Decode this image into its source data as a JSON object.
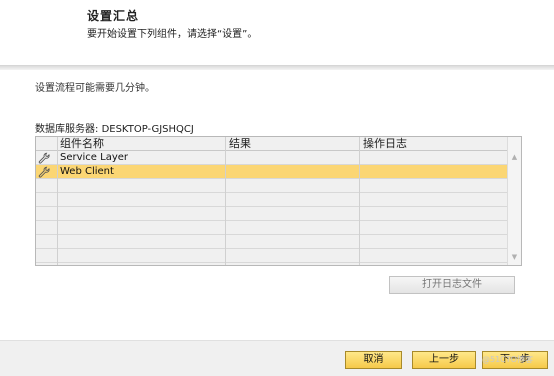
{
  "header": {
    "title": "设置汇总",
    "subtitle": "要开始设置下列组件，请选择“设置”。"
  },
  "info": "设置流程可能需要几分钟。",
  "server": {
    "label": "数据库服务器:",
    "value": "DESKTOP-GJSHQCJ"
  },
  "grid": {
    "columns": [
      "组件名称",
      "结果",
      "操作日志"
    ],
    "rows": [
      {
        "icon": "wrench-icon",
        "name": "Service Layer",
        "result": "",
        "log": "",
        "selected": false
      },
      {
        "icon": "wrench-icon",
        "name": "Web Client",
        "result": "",
        "log": "",
        "selected": true
      }
    ],
    "empty_rows": 7
  },
  "buttons": {
    "open_log": "打开日志文件",
    "cancel": "取消",
    "prev": "上一步",
    "next": "下一步"
  },
  "watermark": "@51CTO博客",
  "colors": {
    "selected_row": "#fbd674",
    "button_yellow": "#f6c94a"
  }
}
